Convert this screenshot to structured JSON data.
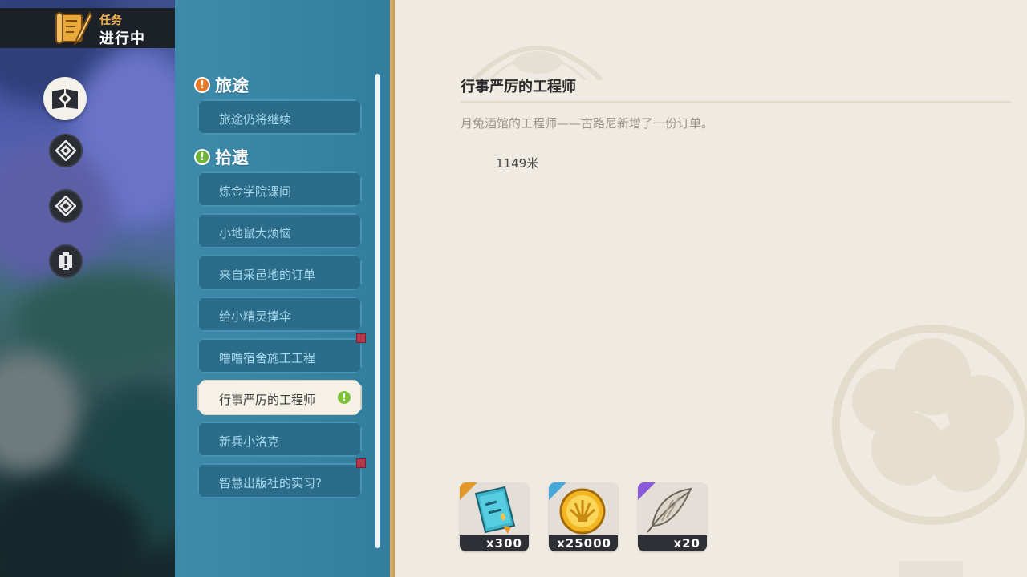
{
  "header": {
    "subtitle": "任务",
    "title": "进行中"
  },
  "nav": [
    {
      "name": "quest-book-icon",
      "active": true
    },
    {
      "name": "compass-icon",
      "active": false
    },
    {
      "name": "diamond-icon",
      "active": false
    },
    {
      "name": "alert-icon",
      "active": false
    }
  ],
  "sections": {
    "journey": {
      "title": "旅途",
      "badge": "!",
      "color": "#e6782a"
    },
    "gleanings": {
      "title": "拾遗",
      "badge": "!",
      "color": "#6fb33a"
    }
  },
  "quests": [
    {
      "label": "旅途仍将继续"
    },
    {
      "label": "炼金学院课间"
    },
    {
      "label": "小地鼠大烦恼"
    },
    {
      "label": "来自采邑地的订单"
    },
    {
      "label": "给小精灵撑伞"
    },
    {
      "label": "噜噜宿舍施工工程"
    },
    {
      "label": "行事严厉的工程师"
    },
    {
      "label": "新兵小洛克"
    },
    {
      "label": "智慧出版社的实习?"
    }
  ],
  "detail": {
    "title": "行事严厉的工程师",
    "description": "月兔酒馆的工程师——古路尼新增了一份订单。",
    "distance": "1149米"
  },
  "rewards": [
    {
      "name": "book-reward",
      "count": "x300",
      "corner_color": "#e39a2a"
    },
    {
      "name": "coin-reward",
      "count": "x25000",
      "corner_color": "#45a8d8"
    },
    {
      "name": "feather-reward",
      "count": "x20",
      "corner_color": "#8a5ad8"
    }
  ],
  "colors": {
    "list_bg": "#3384a6",
    "detail_bg": "#efebe2",
    "accent_gold": "#f0b24a"
  }
}
